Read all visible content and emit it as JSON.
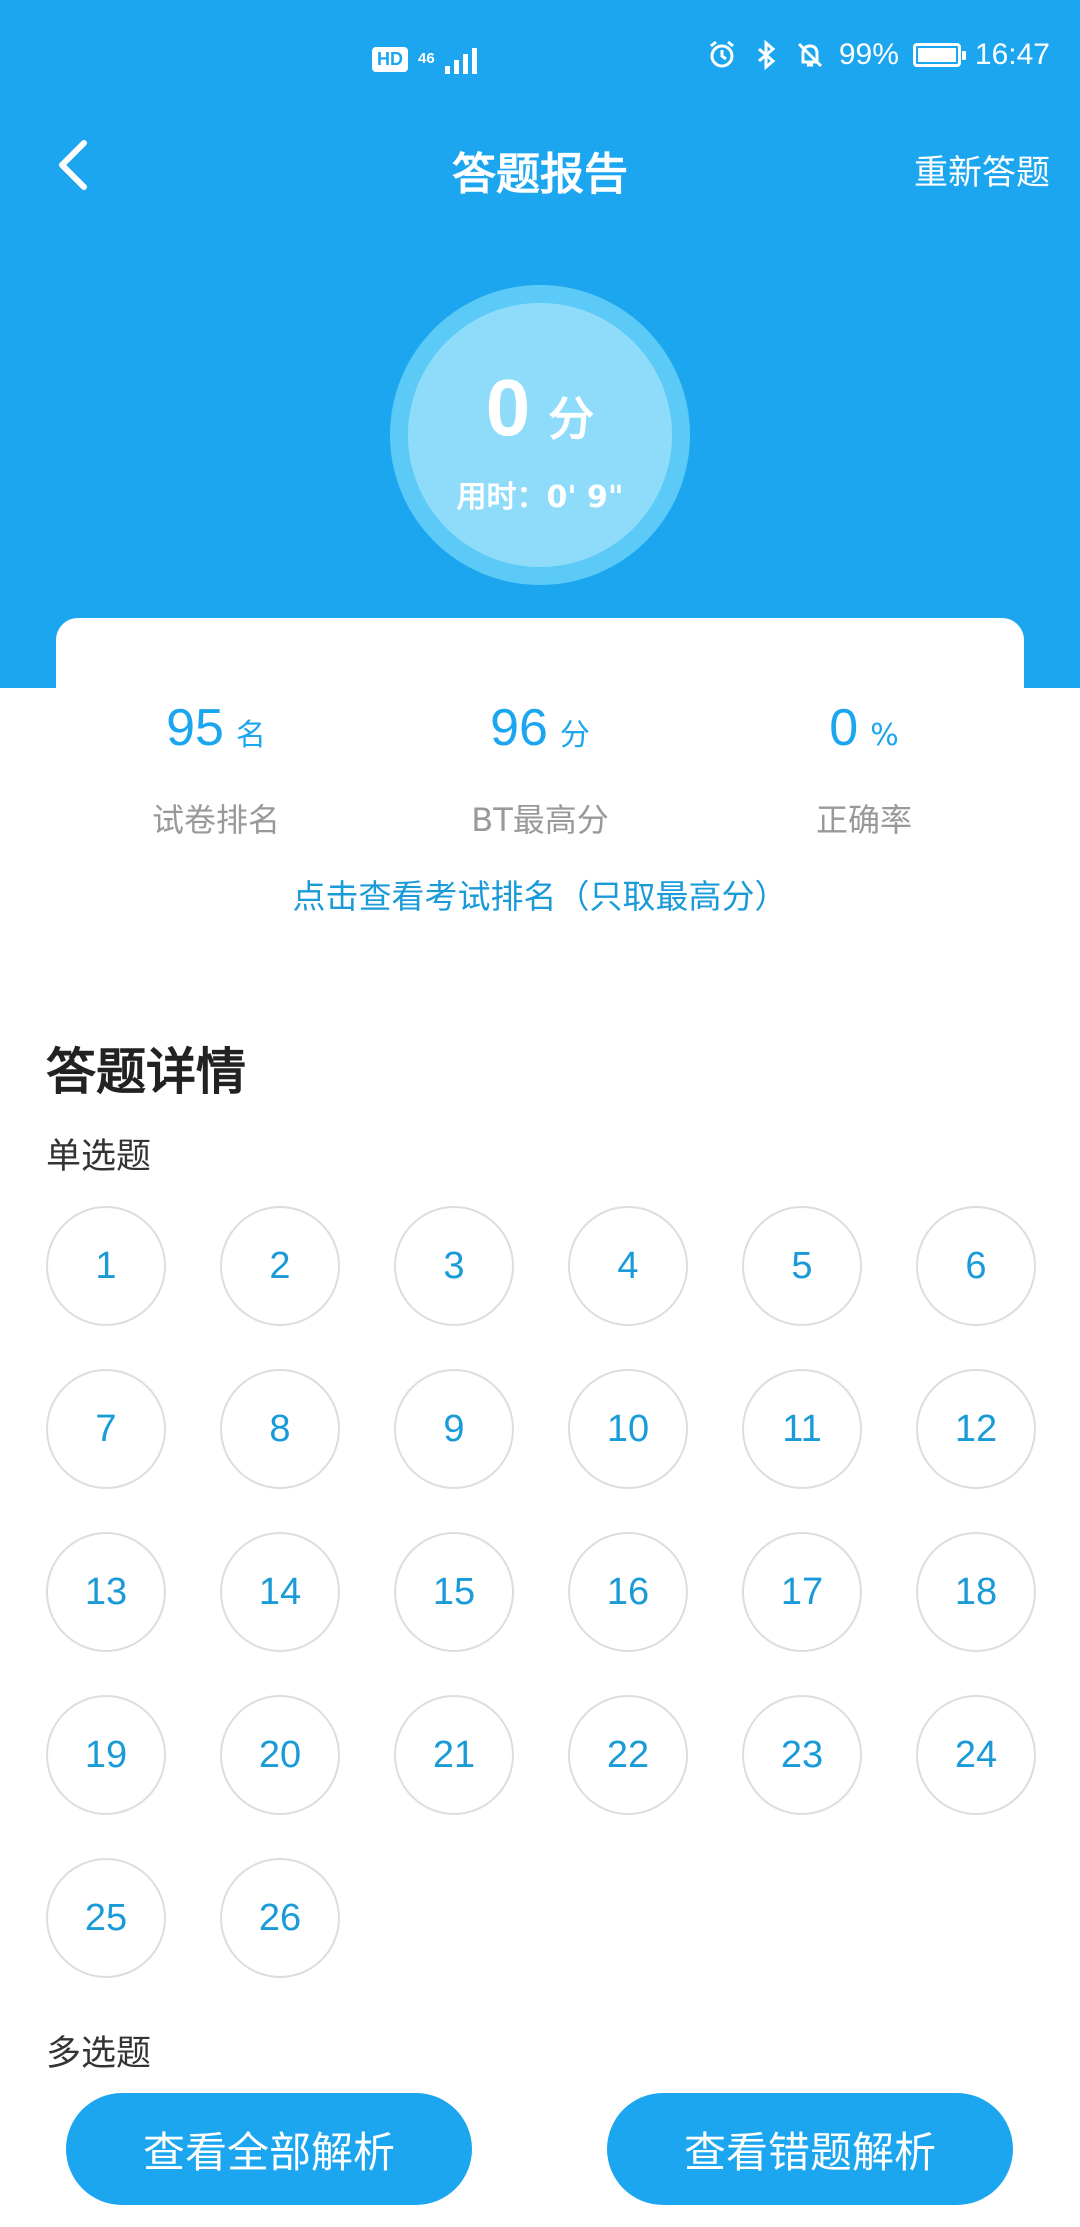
{
  "status_bar": {
    "hd_badge": "HD",
    "network": "46",
    "battery_percent": "99%",
    "time": "16:47",
    "icons": [
      "alarm-icon",
      "bluetooth-icon",
      "mute-icon",
      "battery-icon"
    ]
  },
  "nav": {
    "title": "答题报告",
    "retry_label": "重新答题"
  },
  "score": {
    "value": "0",
    "unit": "分",
    "time_label": "用时：0' 9\""
  },
  "stats": [
    {
      "value": "95",
      "unit": "名",
      "label": "试卷排名"
    },
    {
      "value": "96",
      "unit": "分",
      "label": "BT最高分"
    },
    {
      "value": "0",
      "unit": "%",
      "label": "正确率"
    }
  ],
  "rank_link": "点击查看考试排名（只取最高分）",
  "details": {
    "title": "答题详情",
    "single_choice_label": "单选题",
    "multi_choice_label": "多选题",
    "single_questions": [
      "1",
      "2",
      "3",
      "4",
      "5",
      "6",
      "7",
      "8",
      "9",
      "10",
      "11",
      "12",
      "13",
      "14",
      "15",
      "16",
      "17",
      "18",
      "19",
      "20",
      "21",
      "22",
      "23",
      "24",
      "25",
      "26"
    ]
  },
  "buttons": {
    "view_all": "查看全部解析",
    "view_wrong": "查看错题解析"
  },
  "colors": {
    "primary": "#1ba6ef",
    "link": "#1a9bd8"
  }
}
